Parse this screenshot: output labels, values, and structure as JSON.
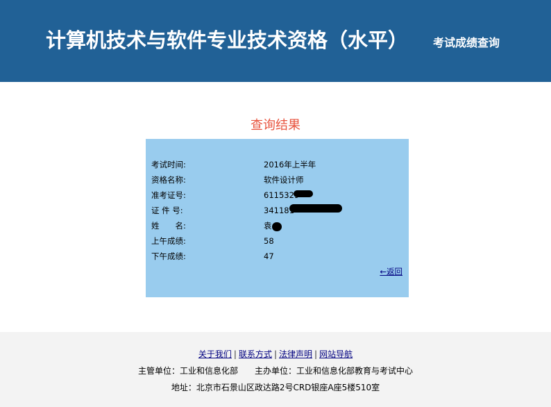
{
  "header": {
    "title": "计算机技术与软件专业技术资格（水平）",
    "subtitle": "考试成绩查询"
  },
  "result": {
    "title": "查询结果",
    "rows": [
      {
        "label": "考试时间:",
        "value": "2016年上半年"
      },
      {
        "label": "资格名称:",
        "value": "软件设计师"
      },
      {
        "label": "准考证号:",
        "value": "6115329"
      },
      {
        "label": "证 件 号:",
        "value": "341181"
      },
      {
        "label": "姓　　名:",
        "value": "袁"
      },
      {
        "label": "上午成绩:",
        "value": "58"
      },
      {
        "label": "下午成绩:",
        "value": "47"
      }
    ],
    "back_link": "←返回"
  },
  "footer": {
    "links": [
      "关于我们",
      "联系方式",
      "法律声明",
      "网站导航"
    ],
    "separator": "|",
    "supervisor": "主管单位：工业和信息化部",
    "organizer": "主办单位：工业和信息化部教育与考试中心",
    "address": "地址：北京市石景山区政达路2号CRD银座A座5楼510室"
  },
  "colors": {
    "header_bg": "#216196",
    "panel_bg": "#99ccee",
    "result_title": "#e8543f",
    "footer_bg": "#f3f3f3"
  }
}
